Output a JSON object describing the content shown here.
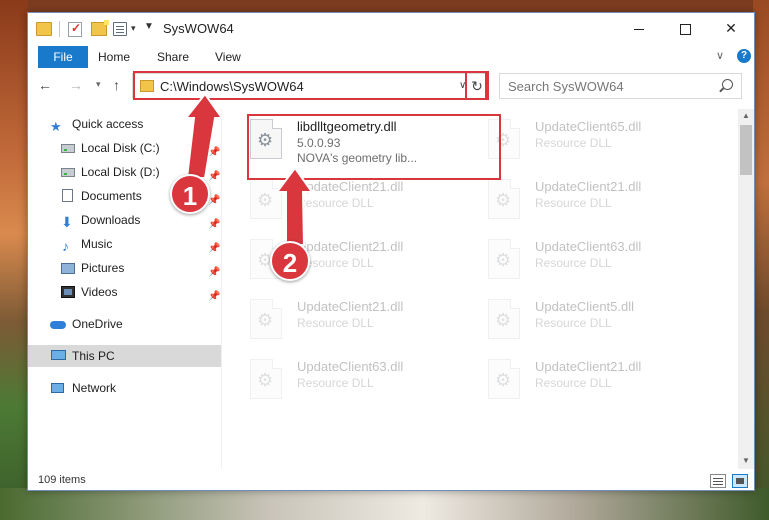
{
  "window": {
    "title": "SysWOW64"
  },
  "ribbon": {
    "file": "File",
    "home": "Home",
    "share": "Share",
    "view": "View"
  },
  "address": {
    "path": "C:\\Windows\\SysWOW64",
    "search_placeholder": "Search SysWOW64"
  },
  "sidebar": {
    "items": [
      {
        "label": "Quick access",
        "icon": "star-icon"
      },
      {
        "label": "Local Disk (C:)",
        "icon": "disk-icon",
        "pinned": true
      },
      {
        "label": "Local Disk (D:)",
        "icon": "disk-icon",
        "pinned": true
      },
      {
        "label": "Documents",
        "icon": "documents-icon",
        "pinned": true
      },
      {
        "label": "Downloads",
        "icon": "download-icon",
        "pinned": true
      },
      {
        "label": "Music",
        "icon": "music-icon",
        "pinned": true
      },
      {
        "label": "Pictures",
        "icon": "pictures-icon",
        "pinned": true
      },
      {
        "label": "Videos",
        "icon": "videos-icon",
        "pinned": true
      },
      {
        "label": "OneDrive",
        "icon": "cloud-icon"
      },
      {
        "label": "This PC",
        "icon": "pc-icon",
        "selected": true
      },
      {
        "label": "Network",
        "icon": "network-icon"
      }
    ]
  },
  "files": [
    {
      "name": "libdlltgeometry.dll",
      "line2": "5.0.0.93",
      "line3": "NOVA's geometry lib...",
      "highlighted": true
    },
    {
      "name": "UpdateClient65.dll",
      "line2": "Resource DLL"
    },
    {
      "name": "UpdateClient21.dll",
      "line2": "Resource DLL"
    },
    {
      "name": "UpdateClient21.dll",
      "line2": "Resource DLL"
    },
    {
      "name": "UpdateClient21.dll",
      "line2": "Resource DLL"
    },
    {
      "name": "UpdateClient63.dll",
      "line2": "Resource DLL"
    },
    {
      "name": "UpdateClient21.dll",
      "line2": "Resource DLL"
    },
    {
      "name": "UpdateClient5.dll",
      "line2": "Resource DLL"
    },
    {
      "name": "UpdateClient63.dll",
      "line2": "Resource DLL"
    },
    {
      "name": "UpdateClient21.dll",
      "line2": "Resource DLL"
    }
  ],
  "status": {
    "count": "109 items"
  },
  "annotations": {
    "step1": "1",
    "step2": "2",
    "color": "#d9363e"
  }
}
